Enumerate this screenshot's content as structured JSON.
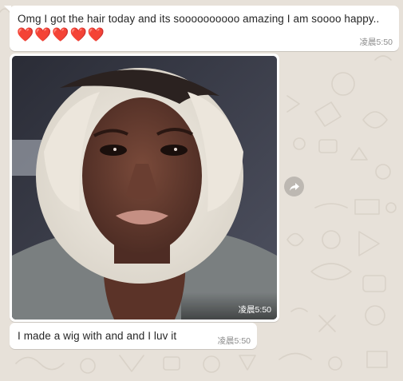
{
  "messages": [
    {
      "text": "Omg I got the hair today and its soooooooooo amazing I am soooo happy..",
      "emoji": "❤️❤️❤️❤️❤️",
      "time": "凌晨5:50"
    },
    {
      "type": "image",
      "time": "凌晨5:50"
    },
    {
      "text": "I made a wig with and and I luv it",
      "time": "凌晨5:50"
    }
  ],
  "icons": {
    "forward": "forward-arrow-icon"
  },
  "colors": {
    "chat_background": "#e7e1d9",
    "bubble": "#ffffff",
    "timestamp": "#8c8c8c",
    "heart": "#e0202c"
  }
}
